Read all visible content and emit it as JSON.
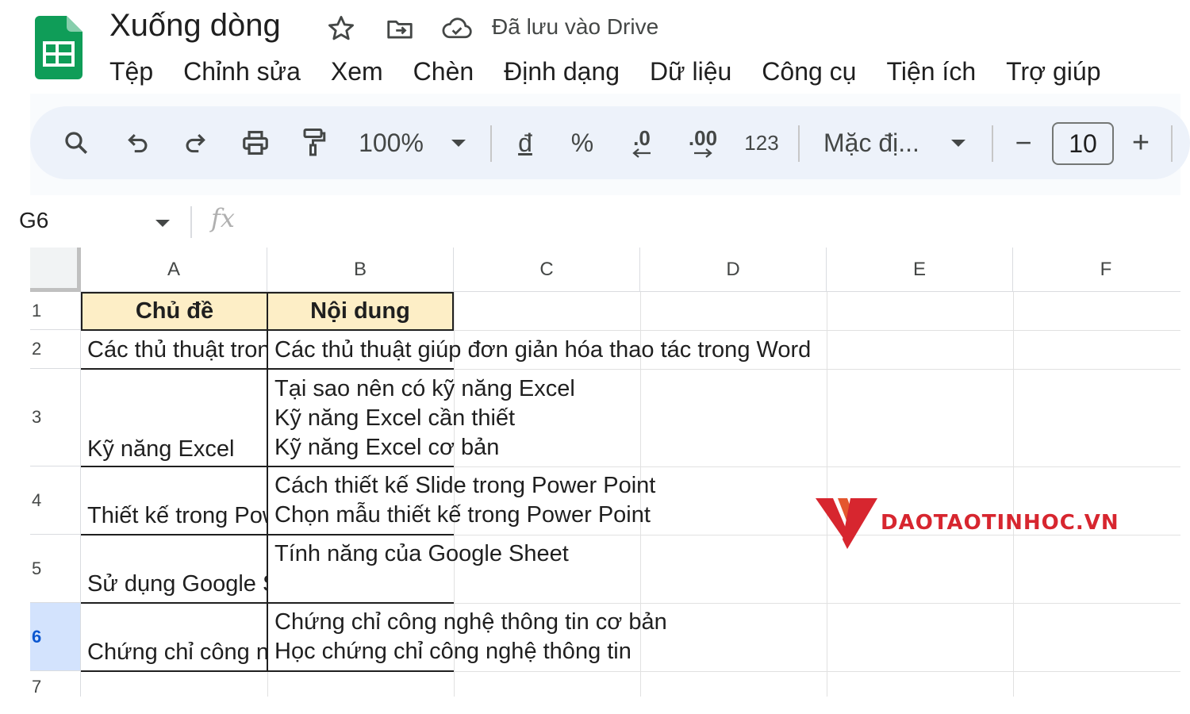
{
  "title_bar": {
    "doc_title": "Xuống dòng",
    "save_status": "Đã lưu vào Drive",
    "icons": [
      "star-icon",
      "move-to-folder-icon",
      "cloud-saved-icon"
    ]
  },
  "menu": {
    "items": [
      {
        "label": "Tệp"
      },
      {
        "label": "Chỉnh sửa"
      },
      {
        "label": "Xem"
      },
      {
        "label": "Chèn"
      },
      {
        "label": "Định dạng"
      },
      {
        "label": "Dữ liệu"
      },
      {
        "label": "Công cụ"
      },
      {
        "label": "Tiện ích"
      },
      {
        "label": "Trợ giúp"
      }
    ]
  },
  "toolbar": {
    "zoom": "100%",
    "currency": "đ",
    "percent": "%",
    "decrease_decimal": ".0",
    "increase_decimal": ".00",
    "number_format": "123",
    "font_name": "Mặc đị...",
    "minus": "−",
    "font_size": "10",
    "plus": "+"
  },
  "formula_bar": {
    "name_box": "G6",
    "fx": "fx",
    "content": ""
  },
  "grid": {
    "columns": [
      "A",
      "B",
      "C",
      "D",
      "E",
      "F"
    ],
    "rows": [
      "1",
      "2",
      "3",
      "4",
      "5",
      "6",
      "7"
    ],
    "active_row": "6",
    "cells": {
      "A1": "Chủ đề",
      "B1": "Nội dung",
      "A2": "Các thủ thuật trong Word",
      "B2": "Các thủ thuật giúp đơn giản hóa thao tác trong Word",
      "A3": "Kỹ năng Excel",
      "B3": "Tại sao nên có kỹ năng Excel\nKỹ năng Excel cần thiết\nKỹ năng Excel cơ bản",
      "A4": "Thiết kế trong Power Point",
      "B4": "Cách thiết kế Slide trong Power Point\nChọn mẫu thiết kế trong Power Point",
      "A5": "Sử dụng Google Sheet",
      "B5": "Tính năng của Google Sheet",
      "A6": "Chứng chỉ công nghệ thông tin",
      "B6": "Chứng chỉ công nghệ thông tin cơ bản\nHọc chứng chỉ công nghệ thông tin"
    }
  },
  "watermark": {
    "text": "DAOTAOTINHOC.VN",
    "color": "#d7262f"
  },
  "colors": {
    "header_fill": "#fdeec6",
    "toolbar_bg": "#edf2fa",
    "sheets_green": "#0f9d58",
    "active_row_bg": "#d3e3fd"
  }
}
